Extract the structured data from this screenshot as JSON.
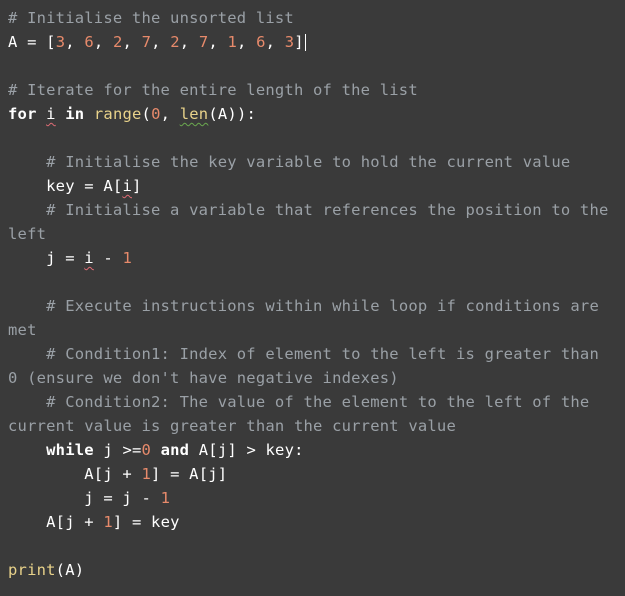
{
  "comments": {
    "init_list": "# Initialise the unsorted list",
    "iterate": "# Iterate for the entire length of the list",
    "init_key": "# Initialise the key variable to hold the current value",
    "init_j": "# Initialise a variable that references the position to the left",
    "exec_while": "# Execute instructions within while loop if conditions are met",
    "cond1": "# Condition1: Index of element to the left is greater than 0 (ensure we don't have negative indexes)",
    "cond2": "# Condition2: The value of the element to the left of the current value is greater than the current value"
  },
  "code": {
    "list_var": "A",
    "assign": " = ",
    "lb": "[",
    "rb": "]",
    "list_values": [
      "3",
      "6",
      "2",
      "7",
      "2",
      "7",
      "1",
      "6",
      "3"
    ],
    "sep": ", ",
    "for_kw": "for",
    "in_kw": "in",
    "loop_var": "i",
    "range_fn": "range",
    "len_fn": "len",
    "open_p": "(",
    "close_p": ")",
    "colon": ":",
    "zero": "0",
    "one": "1",
    "key_var": "key",
    "a_of_i": "A[",
    "close_br": "]",
    "j_var": "j",
    "minus": " - ",
    "while_kw": "while",
    "gte": " >=",
    "and_kw": "and",
    "gt": " > ",
    "a_j": "A[j]",
    "a_j_plus": "A[j + ",
    "print_fn": "print",
    "a_only": "A"
  }
}
